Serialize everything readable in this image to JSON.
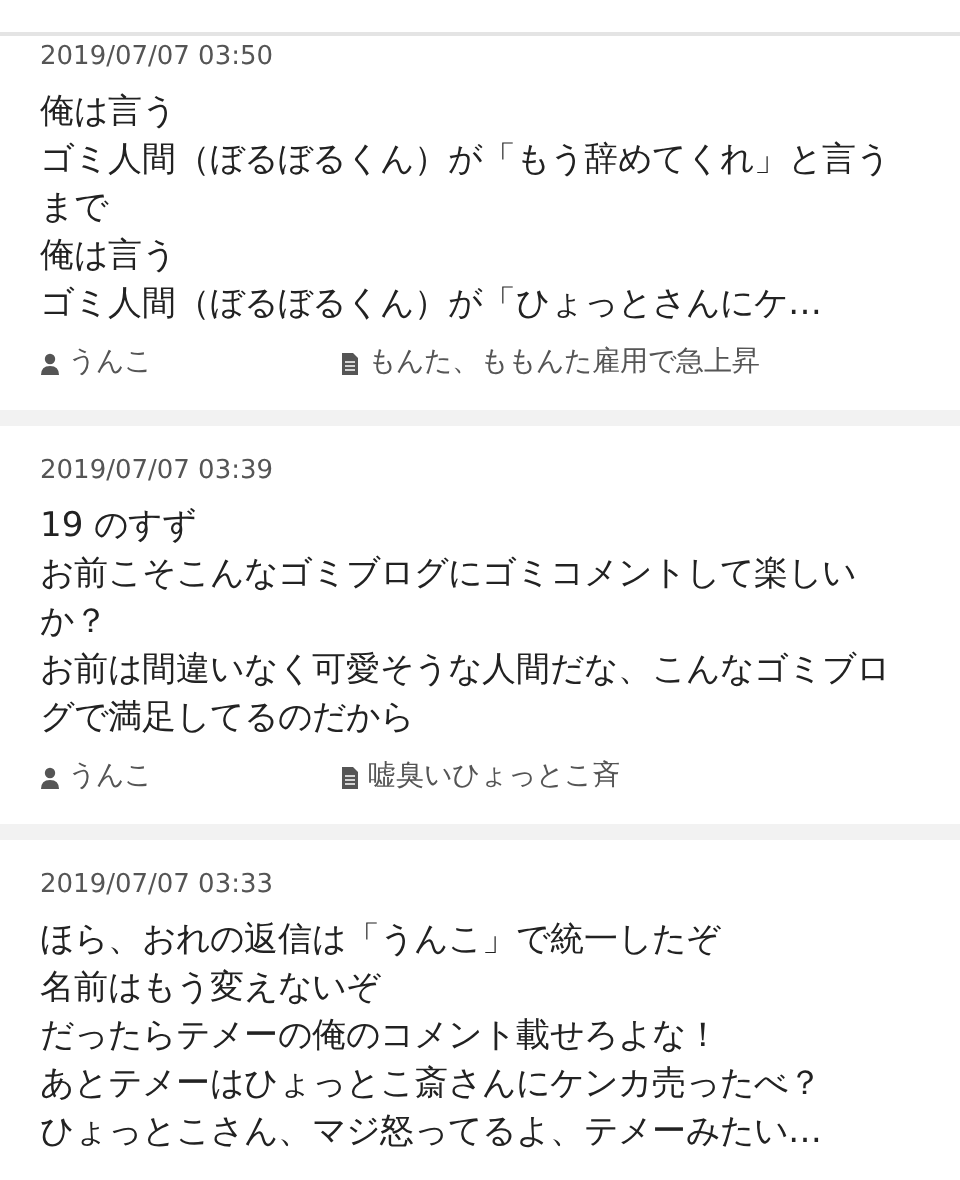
{
  "comments": [
    {
      "date": "2019/07/07 03:50",
      "lines": [
        "俺は言う",
        "ゴミ人間（ぼるぼるくん）が「もう辞めてくれ」と言うまで",
        "俺は言う",
        "ゴミ人間（ぼるぼるくん）が「ひょっとさんにケ…"
      ],
      "author": "うんこ",
      "article": "もんた、ももんた雇用で急上昇"
    },
    {
      "date": "2019/07/07 03:39",
      "lines": [
        "19 のすず",
        "お前こそこんなゴミブログにゴミコメントして楽しいか？",
        "お前は間違いなく可愛そうな人間だな、こんなゴミブログで満足してるのだから"
      ],
      "author": "うんこ",
      "article": "嘘臭いひょっとこ斉"
    },
    {
      "date": "2019/07/07 03:33",
      "lines": [
        "ほら、おれの返信は「うんこ」で統一したぞ",
        "名前はもう変えないぞ",
        "だったらテメーの俺のコメント載せろよな！",
        "あとテメーはひょっとこ斎さんにケンカ売ったべ？",
        "ひょっとこさん、マジ怒ってるよ、テメーみたい…"
      ]
    }
  ]
}
